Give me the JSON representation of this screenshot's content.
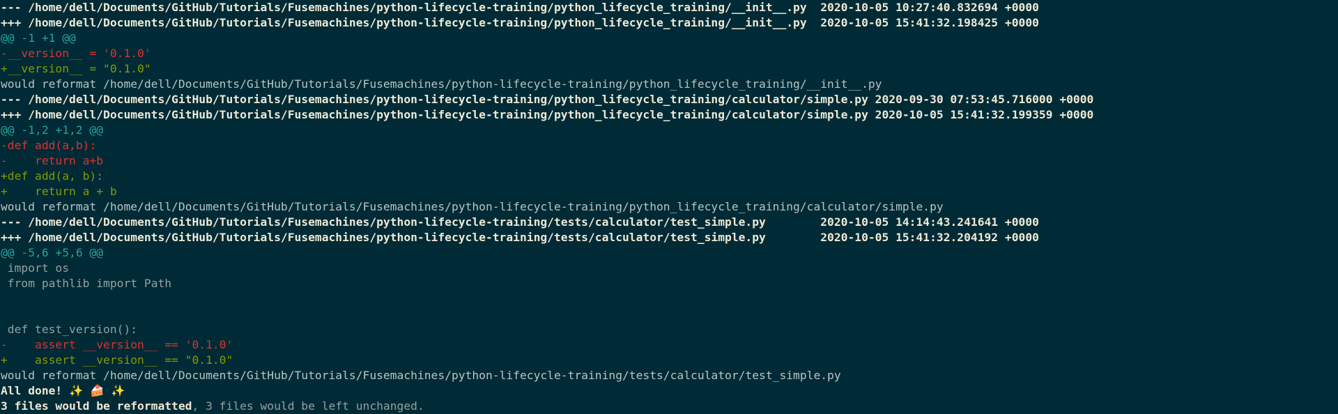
{
  "window": {
    "background": "#002b36"
  },
  "colors": {
    "header": "#eee8d5",
    "hunk": "#2aa198",
    "removed": "#dc322f",
    "added": "#859900",
    "context": "#93a1a1"
  },
  "lines": [
    {
      "kind": "hdr",
      "text": "--- /home/dell/Documents/GitHub/Tutorials/Fusemachines/python-lifecycle-training/python_lifecycle_training/__init__.py  2020-10-05 10:27:40.832694 +0000"
    },
    {
      "kind": "hdr",
      "text": "+++ /home/dell/Documents/GitHub/Tutorials/Fusemachines/python-lifecycle-training/python_lifecycle_training/__init__.py  2020-10-05 15:41:32.198425 +0000"
    },
    {
      "kind": "hunk",
      "text": "@@ -1 +1 @@"
    },
    {
      "kind": "del",
      "text": "-__version__ = '0.1.0'"
    },
    {
      "kind": "add",
      "text": "+__version__ = \"0.1.0\""
    },
    {
      "kind": "info",
      "text": "would reformat /home/dell/Documents/GitHub/Tutorials/Fusemachines/python-lifecycle-training/python_lifecycle_training/__init__.py"
    },
    {
      "kind": "hdr",
      "text": "--- /home/dell/Documents/GitHub/Tutorials/Fusemachines/python-lifecycle-training/python_lifecycle_training/calculator/simple.py 2020-09-30 07:53:45.716000 +0000"
    },
    {
      "kind": "hdr",
      "text": "+++ /home/dell/Documents/GitHub/Tutorials/Fusemachines/python-lifecycle-training/python_lifecycle_training/calculator/simple.py 2020-10-05 15:41:32.199359 +0000"
    },
    {
      "kind": "hunk",
      "text": "@@ -1,2 +1,2 @@"
    },
    {
      "kind": "del",
      "text": "-def add(a,b):"
    },
    {
      "kind": "del",
      "text": "-    return a+b"
    },
    {
      "kind": "add",
      "text": "+def add(a, b):"
    },
    {
      "kind": "add",
      "text": "+    return a + b"
    },
    {
      "kind": "info",
      "text": "would reformat /home/dell/Documents/GitHub/Tutorials/Fusemachines/python-lifecycle-training/python_lifecycle_training/calculator/simple.py"
    },
    {
      "kind": "hdr",
      "text": "--- /home/dell/Documents/GitHub/Tutorials/Fusemachines/python-lifecycle-training/tests/calculator/test_simple.py        2020-10-05 14:14:43.241641 +0000"
    },
    {
      "kind": "hdr",
      "text": "+++ /home/dell/Documents/GitHub/Tutorials/Fusemachines/python-lifecycle-training/tests/calculator/test_simple.py        2020-10-05 15:41:32.204192 +0000"
    },
    {
      "kind": "hunk",
      "text": "@@ -5,6 +5,6 @@"
    },
    {
      "kind": "ctx",
      "text": " import os"
    },
    {
      "kind": "ctx",
      "text": " from pathlib import Path"
    },
    {
      "kind": "ctx",
      "text": ""
    },
    {
      "kind": "ctx",
      "text": ""
    },
    {
      "kind": "ctx",
      "text": " def test_version():"
    },
    {
      "kind": "del",
      "text": "-    assert __version__ == '0.1.0'"
    },
    {
      "kind": "add",
      "text": "+    assert __version__ == \"0.1.0\""
    },
    {
      "kind": "info",
      "text": "would reformat /home/dell/Documents/GitHub/Tutorials/Fusemachines/python-lifecycle-training/tests/calculator/test_simple.py"
    }
  ],
  "done": {
    "text": "All done! ",
    "sparkle_left": "✨",
    "cake": "🍰",
    "sparkle_right": "✨",
    "icon_names": [
      "sparkles-icon",
      "cake-icon",
      "sparkles-icon"
    ]
  },
  "summary": {
    "bold_text": "3 files would be reformatted",
    "rest_text": ", 3 files would be left unchanged."
  }
}
